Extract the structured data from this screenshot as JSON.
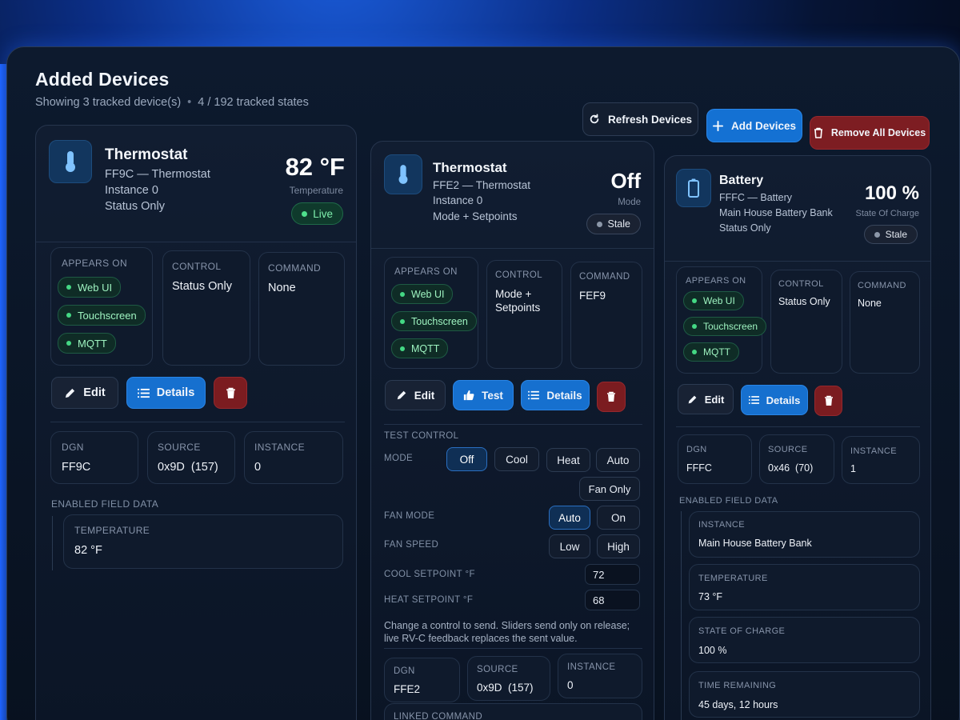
{
  "page": {
    "title": "Added Devices",
    "subtitle_devices": "Showing 3 tracked device(s)",
    "subtitle_sep": "•",
    "subtitle_states": "4 / 192 tracked states"
  },
  "toolbar": {
    "refresh_label": "Refresh Devices",
    "add_label": "Add Devices",
    "remove_label": "Remove All Devices"
  },
  "colors": {
    "accent": "#1670cf",
    "danger": "#7b1c20",
    "live": "#4fe08c"
  },
  "cards": [
    {
      "icon": "thermometer-icon",
      "name": "Thermostat",
      "line1": "FF9C — Thermostat",
      "line2": "Instance 0",
      "line3": "Status Only",
      "value": "82 °F",
      "value_label": "Temperature",
      "status": "Live",
      "appears_on_label": "Appears On",
      "appears_on": [
        "Web UI",
        "Touchscreen",
        "MQTT"
      ],
      "control_label": "Control",
      "control_value": "Status Only",
      "command_label": "Command",
      "command_value": "None",
      "actions": {
        "edit": "Edit",
        "details": "Details"
      },
      "dgn_label": "DGN",
      "dgn": "FF9C",
      "source_label": "Source",
      "source": "0x9D  (157)",
      "instance_label": "Instance",
      "instance": "0",
      "fields_label": "Enabled Field Data",
      "fields": [
        {
          "label": "Temperature",
          "value": "82 °F"
        }
      ]
    },
    {
      "icon": "thermometer-icon",
      "name": "Thermostat",
      "line1": "FFE2 — Thermostat",
      "line2": "Instance 0",
      "line3": "Mode + Setpoints",
      "value": "Off",
      "value_label": "Mode",
      "status": "Stale",
      "appears_on_label": "Appears On",
      "appears_on": [
        "Web UI",
        "Touchscreen",
        "MQTT"
      ],
      "control_label": "Control",
      "control_value_1": "Mode +",
      "control_value_2": "Setpoints",
      "command_label": "Command",
      "command_value": "FEF9",
      "actions": {
        "edit": "Edit",
        "test": "Test",
        "details": "Details"
      },
      "test_control": {
        "label": "Test Control",
        "mode_label": "Mode",
        "modes": [
          "Off",
          "Cool",
          "Heat",
          "Auto",
          "Fan Only"
        ],
        "mode_selected": "Off",
        "fan_mode_label": "Fan Mode",
        "fan_modes": [
          "Auto",
          "On"
        ],
        "fan_mode_selected": "Auto",
        "fan_speed_label": "Fan Speed",
        "fan_speeds": [
          "Low",
          "High"
        ],
        "cool_label": "Cool Setpoint °F",
        "cool_value": "72",
        "heat_label": "Heat Setpoint °F",
        "heat_value": "68",
        "note_1": "Change a control to send. Sliders send only on release;",
        "note_2": "live RV-C feedback replaces the sent value."
      },
      "dgn_label": "DGN",
      "dgn": "FFE2",
      "source_label": "Source",
      "source": "0x9D  (157)",
      "instance_label": "Instance",
      "instance": "0",
      "linked_label": "Linked Command"
    },
    {
      "icon": "battery-icon",
      "name": "Battery",
      "line1": "FFFC — Battery",
      "line2": "Main House Battery Bank",
      "line3": "Status Only",
      "value": "100 %",
      "value_label": "State Of Charge",
      "status": "Stale",
      "appears_on_label": "Appears On",
      "appears_on": [
        "Web UI",
        "Touchscreen",
        "MQTT"
      ],
      "control_label": "Control",
      "control_value": "Status Only",
      "command_label": "Command",
      "command_value": "None",
      "actions": {
        "edit": "Edit",
        "details": "Details"
      },
      "dgn_label": "DGN",
      "dgn": "FFFC",
      "source_label": "Source",
      "source": "0x46  (70)",
      "instance_label": "Instance",
      "instance": "1",
      "fields_label": "Enabled Field Data",
      "fields": [
        {
          "label": "Instance",
          "value": "Main House Battery Bank"
        },
        {
          "label": "Temperature",
          "value": "73 °F"
        },
        {
          "label": "State Of Charge",
          "value": "100 %"
        },
        {
          "label": "Time Remaining",
          "value": "45 days, 12 hours"
        }
      ]
    }
  ]
}
